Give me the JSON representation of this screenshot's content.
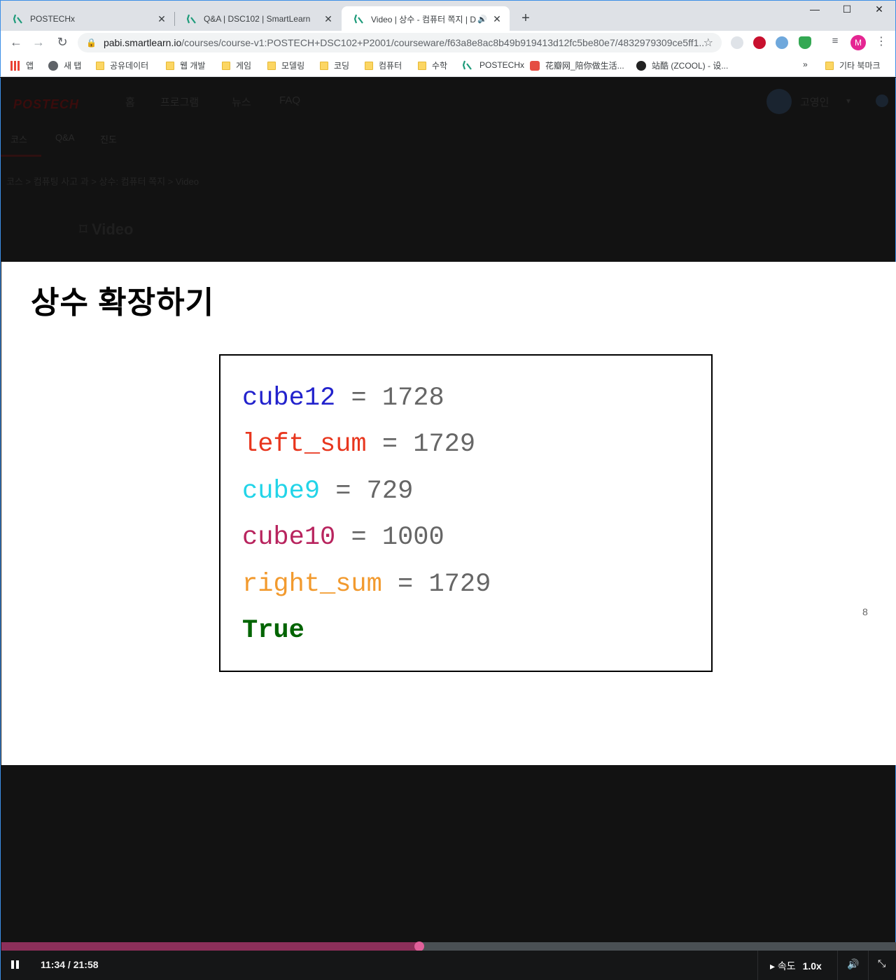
{
  "browser": {
    "tabs": [
      {
        "title": "POSTECHx",
        "close": "✕"
      },
      {
        "title": "Q&A | DSC102 | SmartLearn",
        "close": "✕"
      },
      {
        "title": "Video | 상수 - 컴퓨터 쪽지 | D",
        "close": "✕",
        "audio": "🔊"
      }
    ],
    "new_tab": "+",
    "window_controls": {
      "minimize": "—",
      "maximize": "☐",
      "close": "✕"
    },
    "url_host": "pabi.smartlearn.io",
    "url_path": "/courses/course-v1:POSTECH+DSC102+P2001/courseware/f63a8e8ac8b49b919413d12fc5be80e7/4832979309ce5ff1...",
    "profile_initial": "M",
    "bookmarks": [
      {
        "label": "앱",
        "icon": "apps-grid-icon"
      },
      {
        "label": "새 탭",
        "icon": "globe-icon"
      },
      {
        "label": "공유데이터",
        "icon": "folder-icon"
      },
      {
        "label": "웹 개발",
        "icon": "folder-icon"
      },
      {
        "label": "게임",
        "icon": "folder-icon"
      },
      {
        "label": "모델링",
        "icon": "folder-icon"
      },
      {
        "label": "코딩",
        "icon": "folder-icon"
      },
      {
        "label": "컴퓨터",
        "icon": "folder-icon"
      },
      {
        "label": "수학",
        "icon": "folder-icon"
      },
      {
        "label": "POSTECHx",
        "icon": "smartlearn-icon"
      },
      {
        "label": "花瓣网_陪你做生活...",
        "icon": "huaban-icon"
      },
      {
        "label": "站酷 (ZCOOL) - 设...",
        "icon": "zcool-icon"
      }
    ],
    "bookmarks_overflow": "»",
    "other_bookmarks": "기타 북마크"
  },
  "site": {
    "logo": "POSTECH",
    "nav": [
      "홈",
      "프로그램",
      "뉴스",
      "FAQ"
    ],
    "username": "고영인",
    "subtabs": [
      "코스",
      "Q&A",
      "진도"
    ],
    "breadcrumb": "코스  >  컴퓨팅 사고 과  >  상수: 컴퓨터 쪽지  >  Video",
    "video_heading": "Video"
  },
  "slide": {
    "title": "상수 확장하기",
    "page_number": "8",
    "code_lines": [
      {
        "name": "cube12",
        "op": " = ",
        "value": "1728",
        "color": "#2222cc"
      },
      {
        "name": "left_sum",
        "op": " = ",
        "value": "1729",
        "color": "#e8361e"
      },
      {
        "name": "cube9",
        "op": " = ",
        "value": "729",
        "color": "#22d4e8"
      },
      {
        "name": "cube10",
        "op": " = ",
        "value": "1000",
        "color": "#b8245e"
      },
      {
        "name": "right_sum",
        "op": " = ",
        "value": "1729",
        "color": "#f29a2e"
      }
    ],
    "result": "True"
  },
  "player": {
    "timecode": "11:34 / 21:58",
    "progress_fraction": 0.467,
    "speed_label": "속도",
    "speed_value": "1.0x",
    "accent": "#e0609a"
  }
}
